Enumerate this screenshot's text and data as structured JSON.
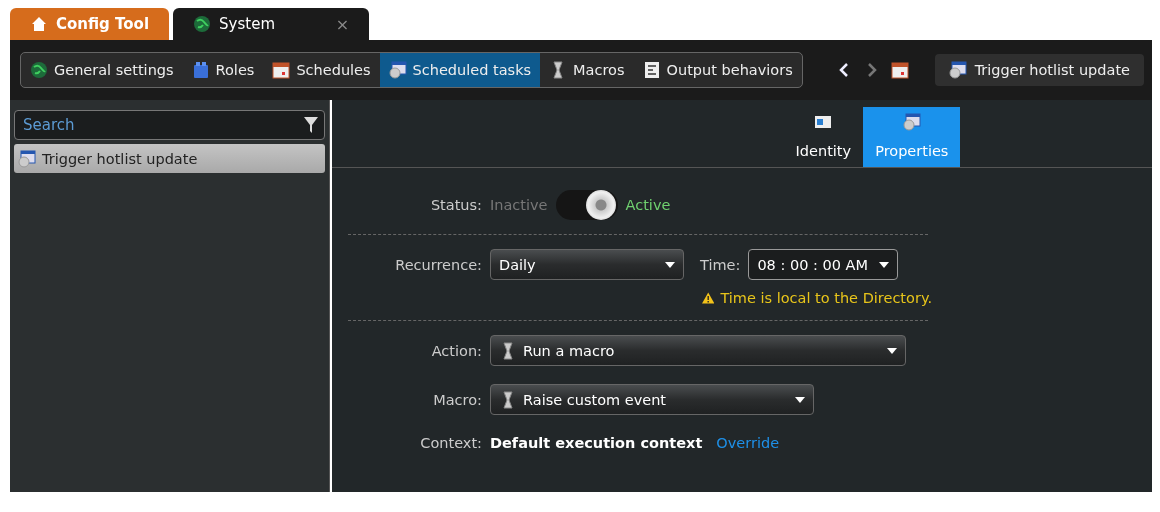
{
  "app_tabs": [
    {
      "label": "Config Tool",
      "kind": "home"
    },
    {
      "label": "System",
      "kind": "globe",
      "close": "×"
    }
  ],
  "task_bar": {
    "items": [
      {
        "label": "General settings",
        "kind": "globe",
        "selected": false
      },
      {
        "label": "Roles",
        "kind": "blocks",
        "selected": false
      },
      {
        "label": "Schedules",
        "kind": "calendar",
        "selected": false
      },
      {
        "label": "Scheduled tasks",
        "kind": "task",
        "selected": true
      },
      {
        "label": "Macros",
        "kind": "macro",
        "selected": false
      },
      {
        "label": "Output behaviors",
        "kind": "output",
        "selected": false
      }
    ],
    "back_enabled": true,
    "forward_enabled": false,
    "current_entity": "Trigger hotlist update"
  },
  "sidebar": {
    "search": {
      "placeholder": "Search"
    },
    "items": [
      {
        "label": "Trigger hotlist update",
        "selected": true
      }
    ]
  },
  "page_tabs": [
    {
      "label": "Identity",
      "kind": "identity",
      "selected": false
    },
    {
      "label": "Properties",
      "kind": "task",
      "selected": true
    }
  ],
  "form": {
    "status": {
      "label": "Status:",
      "off_label": "Inactive",
      "on_label": "Active",
      "on": true
    },
    "recurrence": {
      "label": "Recurrence:",
      "value": "Daily"
    },
    "time": {
      "label": "Time:",
      "value": "08 : 00 : 00 AM"
    },
    "warning": "Time is local to the Directory.",
    "action": {
      "label": "Action:",
      "value": "Run a macro"
    },
    "macro": {
      "label": "Macro:",
      "value": "Raise custom event"
    },
    "context": {
      "label": "Context:",
      "value": "Default execution context",
      "link": "Override"
    }
  }
}
